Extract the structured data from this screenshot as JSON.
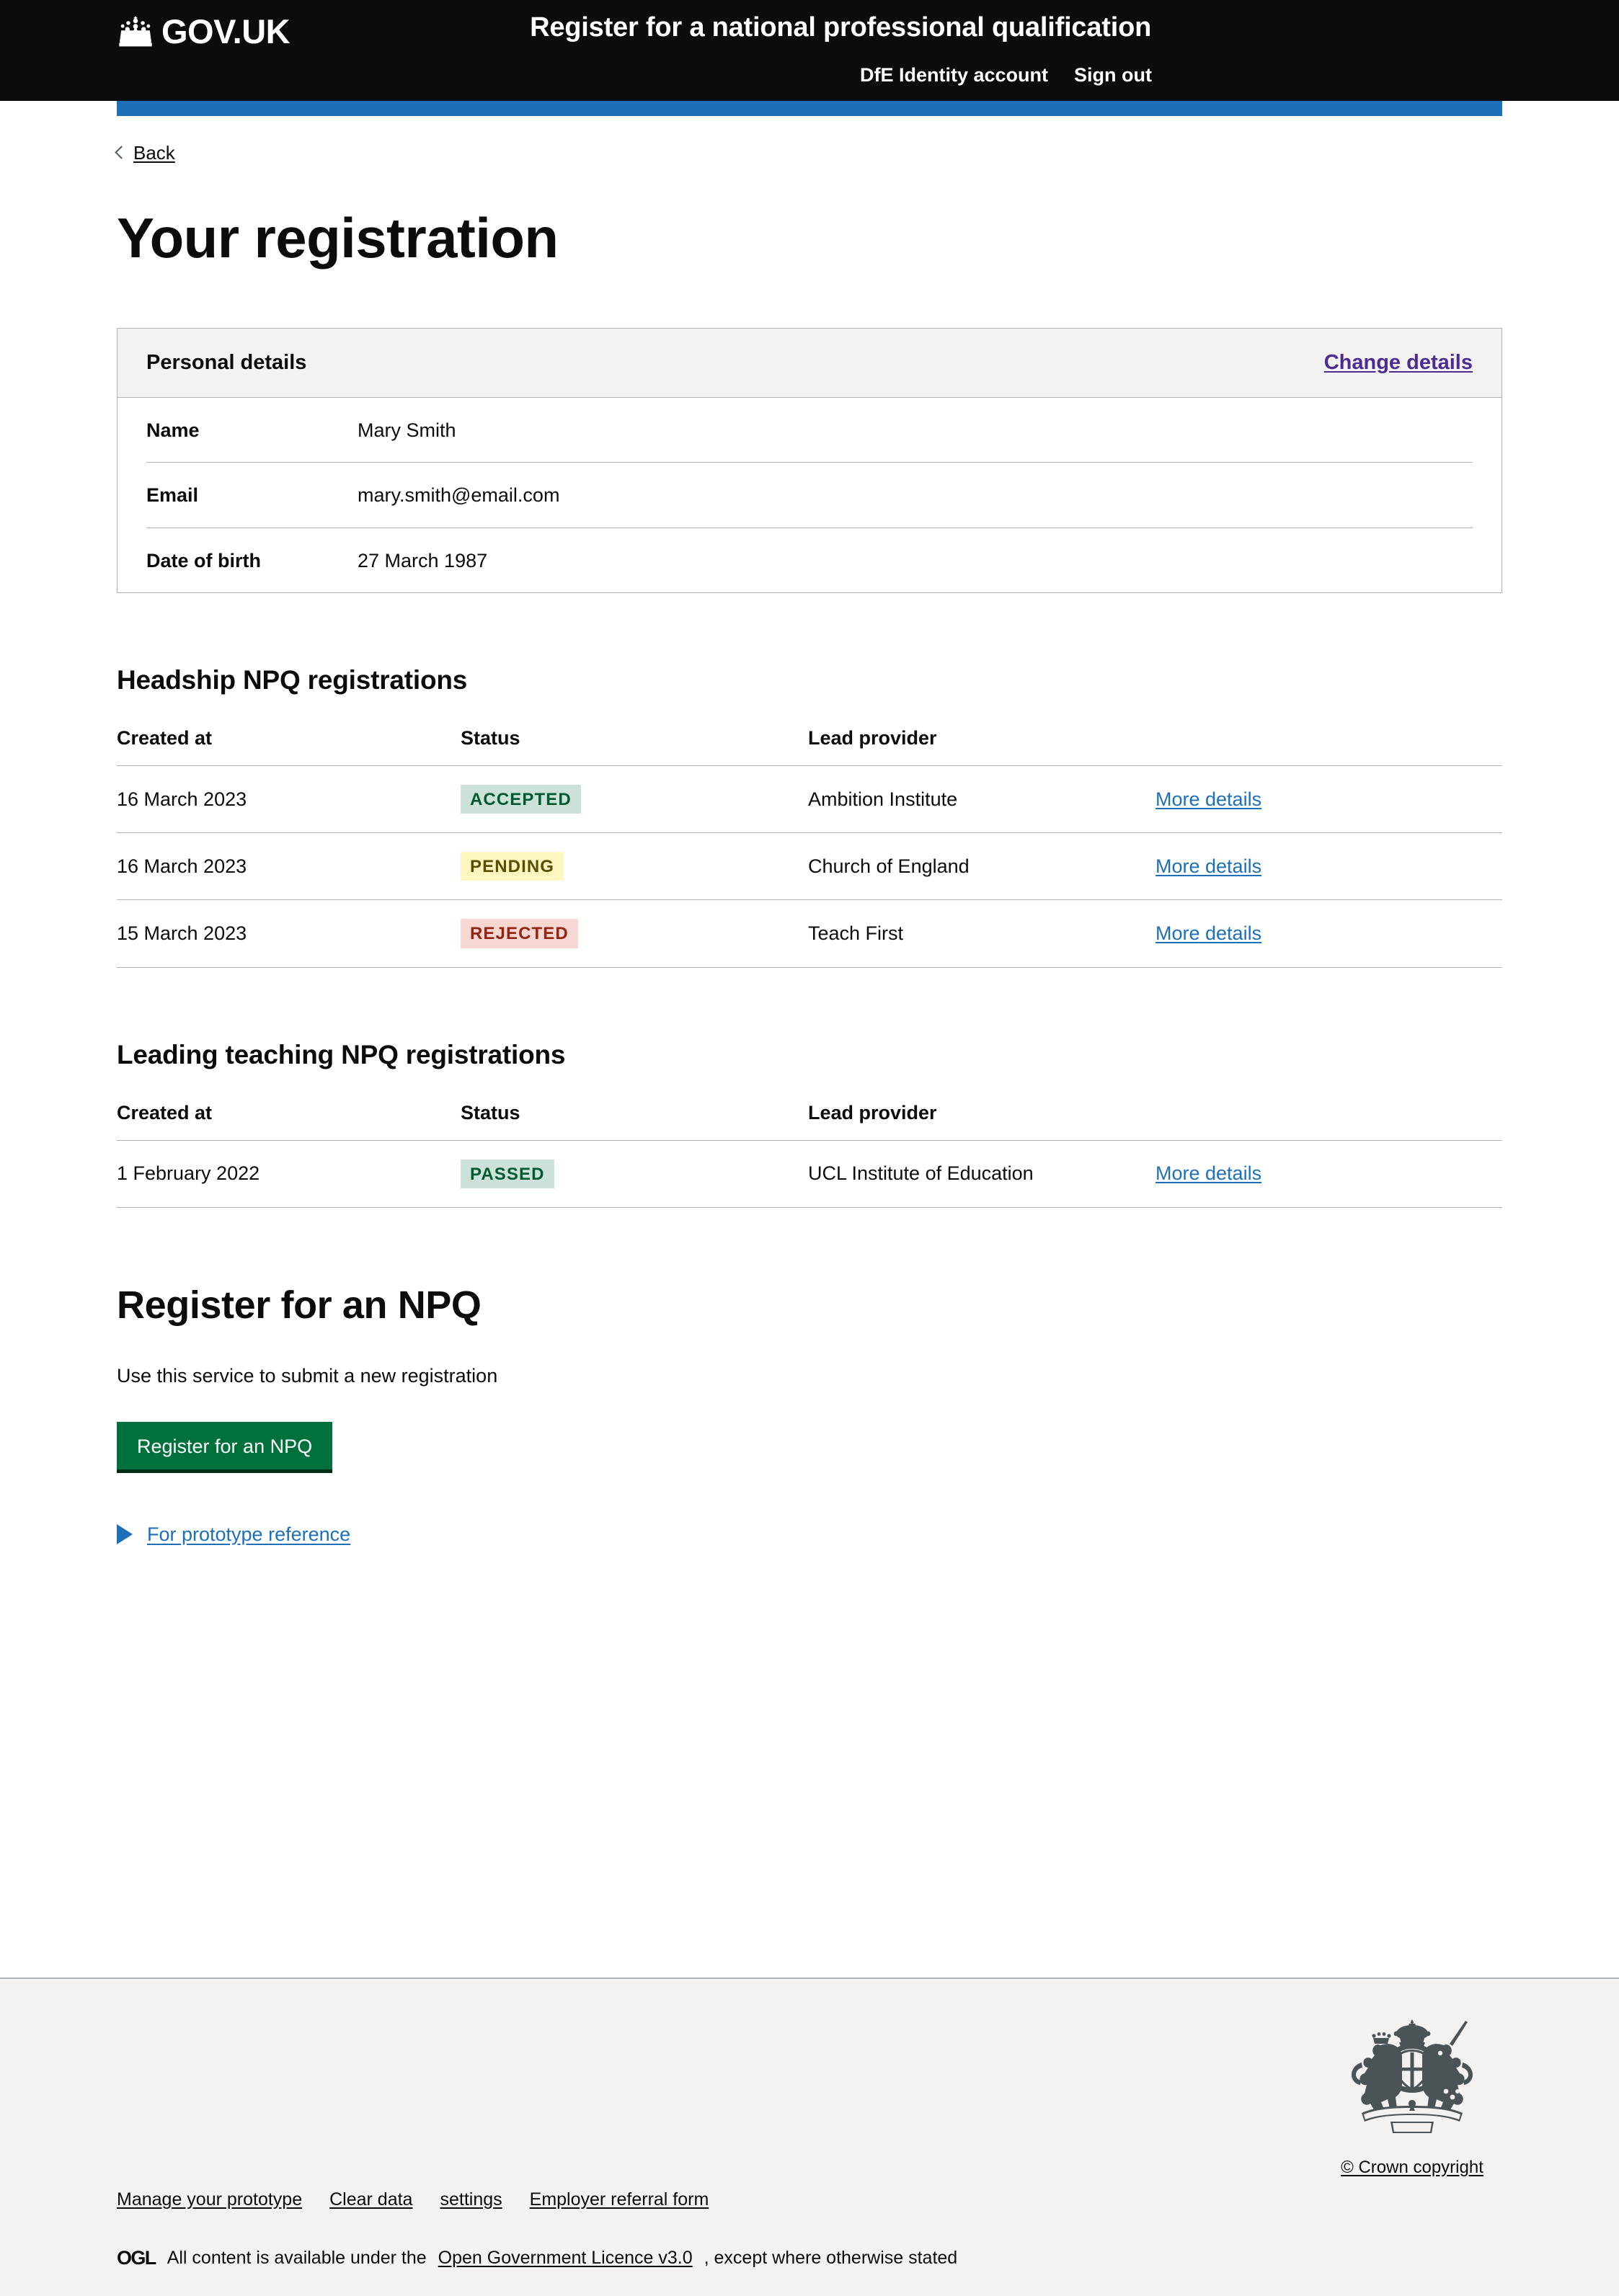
{
  "header": {
    "logo_text": "GOV.UK",
    "crown_icon": "crown-icon",
    "service_name": "Register for a national professional qualification",
    "nav": [
      {
        "label": "DfE Identity account"
      },
      {
        "label": "Sign out"
      }
    ],
    "service_bar_color": "#1d70b8",
    "background_color": "#0b0c0c"
  },
  "back_link": {
    "label": "Back",
    "icon": "chevron-left-icon"
  },
  "page": {
    "title": "Your registration"
  },
  "personal_details": {
    "card_title": "Personal details",
    "change_link": "Change details",
    "change_link_color": "#4c2c92",
    "rows": [
      {
        "key": "Name",
        "value": "Mary Smith"
      },
      {
        "key": "Email",
        "value": "mary.smith@email.com"
      },
      {
        "key": "Date of birth",
        "value": "27 March 1987"
      }
    ]
  },
  "tables": [
    {
      "heading": "Headship NPQ registrations",
      "columns": [
        "Created at",
        "Status",
        "Lead provider",
        ""
      ],
      "rows": [
        {
          "created_at": "16 March 2023",
          "status": "ACCEPTED",
          "status_variant": "green",
          "lead_provider": "Ambition Institute",
          "action": "More details"
        },
        {
          "created_at": "16 March 2023",
          "status": "PENDING",
          "status_variant": "yellow",
          "lead_provider": "Church of England",
          "action": "More details"
        },
        {
          "created_at": "15 March 2023",
          "status": "REJECTED",
          "status_variant": "red",
          "lead_provider": "Teach First",
          "action": "More details"
        }
      ]
    },
    {
      "heading": "Leading teaching NPQ registrations",
      "columns": [
        "Created at",
        "Status",
        "Lead provider",
        ""
      ],
      "rows": [
        {
          "created_at": "1 February 2022",
          "status": "PASSED",
          "status_variant": "green",
          "lead_provider": "UCL Institute of Education",
          "action": "More details"
        }
      ]
    }
  ],
  "cta": {
    "heading": "Register for an NPQ",
    "body": "Use this service to submit a new registration",
    "button_label": "Register for an NPQ",
    "button_color": "#00703c",
    "details_summary": "For prototype reference",
    "details_icon": "triangle-right-icon"
  },
  "footer": {
    "links": [
      {
        "label": "Manage your prototype"
      },
      {
        "label": "Clear data"
      },
      {
        "label": "settings"
      },
      {
        "label": "Employer referral form"
      }
    ],
    "ogl_logo_text": "OGL",
    "licence_prefix": "All content is available under the",
    "licence_link": "Open Government Licence v3.0",
    "licence_suffix": ", except where otherwise stated",
    "crown_copyright": "© Crown copyright",
    "crest_icon": "royal-coat-of-arms-icon",
    "background_color": "#f3f2f1"
  },
  "tag_colors": {
    "green_bg": "#cce2d8",
    "green_text": "#005a30",
    "yellow_bg": "#fff7bf",
    "yellow_text": "#594d00",
    "red_bg": "#f6d7d2",
    "red_text": "#942514"
  },
  "link_color": "#1d70b8"
}
